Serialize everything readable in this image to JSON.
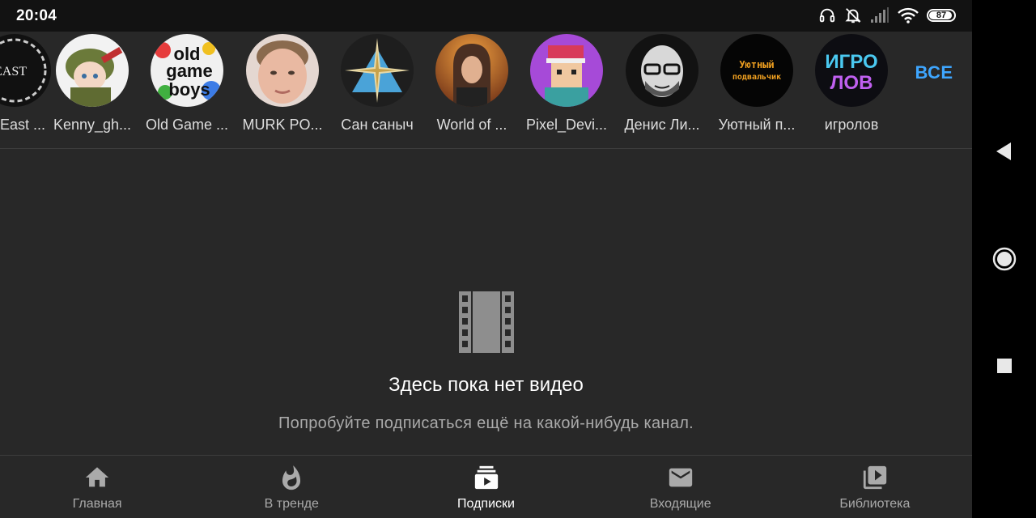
{
  "status_bar": {
    "time": "20:04",
    "battery_level": "87",
    "icons": [
      "headphones-icon",
      "muted-bell-icon",
      "signal-icon",
      "wifi-icon",
      "battery-icon"
    ]
  },
  "channels": {
    "items": [
      {
        "name": "East ...",
        "avatar": "dark-logo-avatar"
      },
      {
        "name": "Kenny_gh...",
        "avatar": "anime-soldier-avatar"
      },
      {
        "name": "Old Game ...",
        "avatar": "old-game-boys-logo-avatar"
      },
      {
        "name": "MURK PO...",
        "avatar": "face-photo-avatar"
      },
      {
        "name": "Сан саныч",
        "avatar": "compass-star-avatar"
      },
      {
        "name": "World of ...",
        "avatar": "person-photo-avatar"
      },
      {
        "name": "Pixel_Devi...",
        "avatar": "pixel-character-avatar"
      },
      {
        "name": "Денис Ли...",
        "avatar": "bearded-man-avatar"
      },
      {
        "name": "Уютный п...",
        "avatar": "cozy-basement-logo-avatar"
      },
      {
        "name": "игролов",
        "avatar": "igrolov-logo-avatar"
      }
    ],
    "all_label": "ВСЕ",
    "avatar_text": {
      "east": "EAST",
      "old_game_boys": [
        "old",
        "game",
        "boys"
      ],
      "cozy": [
        "Уютный",
        "подвальчик"
      ],
      "igrolov": [
        "ИГРО",
        "ЛОВ"
      ]
    }
  },
  "empty_state": {
    "icon": "film-strip-icon",
    "title": "Здесь пока нет видео",
    "subtitle": "Попробуйте подписаться ещё на какой-нибудь канал."
  },
  "bottom_nav": {
    "items": [
      {
        "label": "Главная",
        "icon": "home-icon"
      },
      {
        "label": "В тренде",
        "icon": "flame-icon"
      },
      {
        "label": "Подписки",
        "icon": "subscriptions-icon",
        "active": true
      },
      {
        "label": "Входящие",
        "icon": "mail-icon"
      },
      {
        "label": "Библиотека",
        "icon": "library-icon"
      }
    ]
  },
  "system_nav": {
    "buttons": [
      "back-icon",
      "home-circle-icon",
      "recents-icon"
    ]
  },
  "colors": {
    "background": "#282828",
    "status_bar": "#121212",
    "accent": "#3ea6ff",
    "text_primary": "#ffffff",
    "text_secondary": "#aaaaaa"
  }
}
